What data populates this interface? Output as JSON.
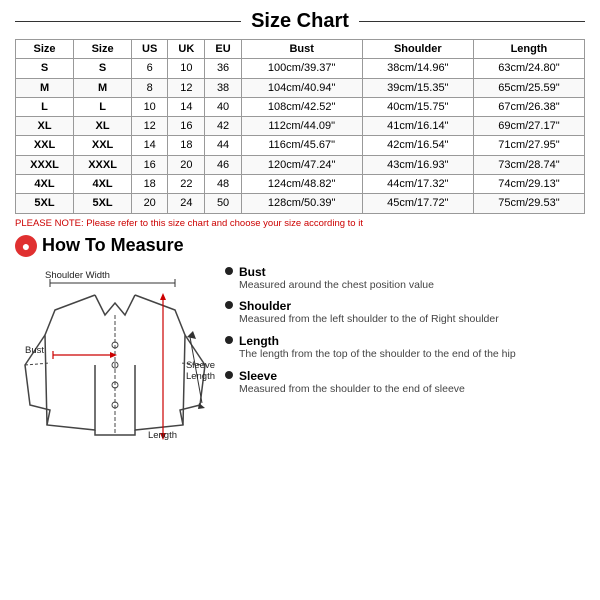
{
  "title": "Size Chart",
  "table": {
    "headers": [
      "Size",
      "Size",
      "US",
      "UK",
      "EU",
      "Bust",
      "Shoulder",
      "Length"
    ],
    "rows": [
      [
        "S",
        "S",
        "6",
        "10",
        "36",
        "100cm/39.37\"",
        "38cm/14.96\"",
        "63cm/24.80\""
      ],
      [
        "M",
        "M",
        "8",
        "12",
        "38",
        "104cm/40.94\"",
        "39cm/15.35\"",
        "65cm/25.59\""
      ],
      [
        "L",
        "L",
        "10",
        "14",
        "40",
        "108cm/42.52\"",
        "40cm/15.75\"",
        "67cm/26.38\""
      ],
      [
        "XL",
        "XL",
        "12",
        "16",
        "42",
        "112cm/44.09\"",
        "41cm/16.14\"",
        "69cm/27.17\""
      ],
      [
        "XXL",
        "XXL",
        "14",
        "18",
        "44",
        "116cm/45.67\"",
        "42cm/16.54\"",
        "71cm/27.95\""
      ],
      [
        "XXXL",
        "XXXL",
        "16",
        "20",
        "46",
        "120cm/47.24\"",
        "43cm/16.93\"",
        "73cm/28.74\""
      ],
      [
        "4XL",
        "4XL",
        "18",
        "22",
        "48",
        "124cm/48.82\"",
        "44cm/17.32\"",
        "74cm/29.13\""
      ],
      [
        "5XL",
        "5XL",
        "20",
        "24",
        "50",
        "128cm/50.39\"",
        "45cm/17.72\"",
        "75cm/29.53\""
      ]
    ]
  },
  "note": "PLEASE NOTE: Please refer to this size chart and choose your size according to it",
  "how_to_measure": {
    "title": "How To Measure",
    "circle_label": "●",
    "labels": {
      "shoulder_width": "Shoulder Width",
      "bust": "Bust",
      "sleeve_length": "Sleeve\nLength",
      "length": "Length"
    },
    "items": [
      {
        "title": "Bust",
        "desc": "Measured around the chest position value"
      },
      {
        "title": "Shoulder",
        "desc": "Measured from the left shoulder to the of Right shoulder"
      },
      {
        "title": "Length",
        "desc": "The length from the top of the shoulder to the end of the hip"
      },
      {
        "title": "Sleeve",
        "desc": "Measured from the shoulder to the end of sleeve"
      }
    ]
  }
}
